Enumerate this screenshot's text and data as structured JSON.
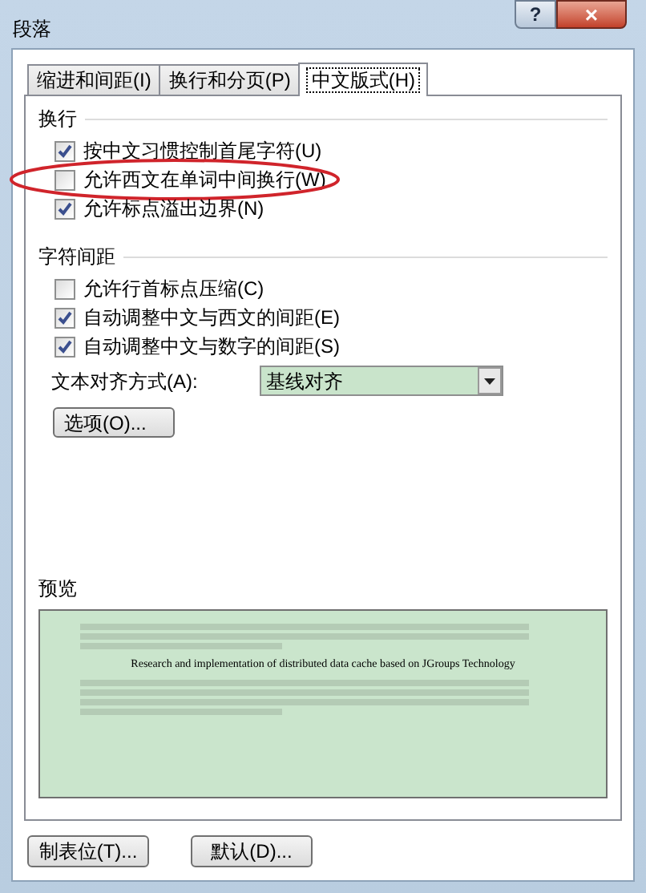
{
  "window": {
    "title": "段落",
    "help": "?",
    "close": "×"
  },
  "tabs": [
    {
      "label": "缩进和间距(I)",
      "selected": false
    },
    {
      "label": "换行和分页(P)",
      "selected": false
    },
    {
      "label": "中文版式(H)",
      "selected": true
    }
  ],
  "line_break": {
    "heading": "换行",
    "options": [
      {
        "label": "按中文习惯控制首尾字符(U)",
        "checked": true,
        "circled": false
      },
      {
        "label": "允许西文在单词中间换行(W)",
        "checked": false,
        "circled": true
      },
      {
        "label": "允许标点溢出边界(N)",
        "checked": true,
        "circled": false
      }
    ]
  },
  "spacing": {
    "heading": "字符间距",
    "options": [
      {
        "label": "允许行首标点压缩(C)",
        "checked": false
      },
      {
        "label": "自动调整中文与西文的间距(E)",
        "checked": true
      },
      {
        "label": "自动调整中文与数字的间距(S)",
        "checked": true
      }
    ],
    "align_label": "文本对齐方式(A):",
    "align_value": "基线对齐",
    "options_button": "选项(O)..."
  },
  "preview": {
    "heading": "预览",
    "sample": "Research and implementation of distributed data cache based on JGroups Technology"
  },
  "buttons": [
    "制表位(T)...",
    "默认(D)..."
  ]
}
